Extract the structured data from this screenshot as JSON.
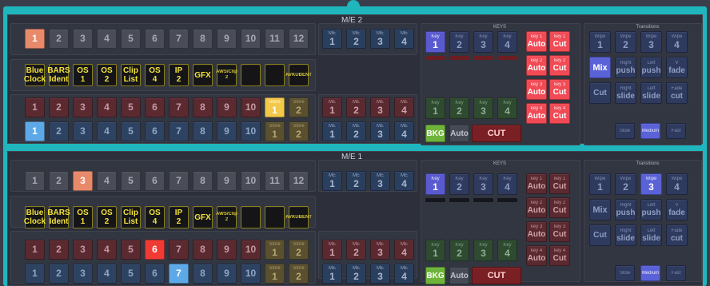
{
  "banks": [
    {
      "title": "M/E 2",
      "keys_title": "KEYS",
      "transitions_title": "Transitions",
      "row1": {
        "labels": [
          "1",
          "2",
          "3",
          "4",
          "5",
          "6",
          "7",
          "8",
          "9",
          "10",
          "11",
          "12"
        ],
        "active_index": 0
      },
      "aux": [
        {
          "top": "Blue",
          "bottom": "Clock"
        },
        {
          "top": "BARS",
          "bottom": "Ident"
        },
        {
          "top": "OS",
          "bottom": "1"
        },
        {
          "top": "OS",
          "bottom": "2"
        },
        {
          "top": "Clip",
          "bottom": "List"
        },
        {
          "top": "OS",
          "bottom": "4"
        },
        {
          "top": "IP",
          "bottom": "2"
        },
        {
          "top": "GFX",
          "bottom": ""
        },
        {
          "top": "AWS/Clip",
          "bottom": "2"
        },
        {
          "top": "",
          "bottom": ""
        },
        {
          "top": "",
          "bottom": ""
        },
        {
          "top": "AVKUBENT",
          "bottom": ""
        }
      ],
      "program": {
        "labels": [
          "1",
          "2",
          "3",
          "4",
          "5",
          "6",
          "7",
          "8",
          "9",
          "10"
        ],
        "active_index": -1
      },
      "preview": {
        "labels": [
          "1",
          "2",
          "3",
          "4",
          "5",
          "6",
          "7",
          "8",
          "9",
          "10"
        ],
        "active_index": 0
      },
      "store_prog": [
        {
          "top": "Store",
          "bottom": "1",
          "on": true
        },
        {
          "top": "Store",
          "bottom": "2",
          "on": false
        }
      ],
      "store_prev": [
        {
          "top": "Store",
          "bottom": "1",
          "on": false
        },
        {
          "top": "Store",
          "bottom": "2",
          "on": false
        }
      ],
      "me_top": [
        {
          "t": "ME",
          "n": "1"
        },
        {
          "t": "ME",
          "n": "2"
        },
        {
          "t": "ME",
          "n": "3"
        },
        {
          "t": "ME",
          "n": "4"
        }
      ],
      "me_prog": [
        {
          "t": "ME",
          "n": "1"
        },
        {
          "t": "ME",
          "n": "2"
        },
        {
          "t": "ME",
          "n": "3"
        },
        {
          "t": "ME",
          "n": "4"
        }
      ],
      "me_prev": [
        {
          "t": "ME",
          "n": "1"
        },
        {
          "t": "ME",
          "n": "2"
        },
        {
          "t": "ME",
          "n": "3"
        },
        {
          "t": "ME",
          "n": "4"
        }
      ],
      "key_sel": [
        {
          "t": "Key",
          "n": "1",
          "on": true
        },
        {
          "t": "Key",
          "n": "2",
          "on": false
        },
        {
          "t": "Key",
          "n": "3",
          "on": false
        },
        {
          "t": "Key",
          "n": "4",
          "on": false
        }
      ],
      "key_bars": [
        "red",
        "red",
        "red",
        "red"
      ],
      "key_green": [
        {
          "t": "Key",
          "n": "1"
        },
        {
          "t": "Key",
          "n": "2"
        },
        {
          "t": "Key",
          "n": "3"
        },
        {
          "t": "Key",
          "n": "4"
        }
      ],
      "key_ac": [
        [
          {
            "t": "key 1",
            "n": "Auto",
            "on": true
          },
          {
            "t": "key 1",
            "n": "Cut",
            "on": true
          }
        ],
        [
          {
            "t": "key 2",
            "n": "Auto",
            "on": true
          },
          {
            "t": "key 2",
            "n": "Cut",
            "on": true
          }
        ],
        [
          {
            "t": "key 3",
            "n": "Auto",
            "on": true
          },
          {
            "t": "key 3",
            "n": "Cut",
            "on": true
          }
        ],
        [
          {
            "t": "key 4",
            "n": "Auto",
            "on": true
          },
          {
            "t": "key 4",
            "n": "Cut",
            "on": true
          }
        ]
      ],
      "bkg": {
        "label": "BKG",
        "on": true
      },
      "auto_label": "Auto",
      "cut_label": "CUT",
      "wipes": [
        {
          "t": "Wipe",
          "n": "1",
          "on": false
        },
        {
          "t": "Wipe",
          "n": "2",
          "on": false
        },
        {
          "t": "Wipe",
          "n": "3",
          "on": false
        },
        {
          "t": "Wipe",
          "n": "4",
          "on": false
        }
      ],
      "mix": {
        "label": "Mix",
        "on": true
      },
      "pushes": [
        {
          "t": "Right",
          "n": "push"
        },
        {
          "t": "Left",
          "n": "push"
        },
        {
          "t": "V",
          "n": "fade"
        }
      ],
      "cut_tr": {
        "label": "Cut"
      },
      "slides": [
        {
          "t": "Right",
          "n": "slide"
        },
        {
          "t": "Left",
          "n": "slide"
        },
        {
          "t": "Fade",
          "n": "cut"
        }
      ],
      "speeds": [
        {
          "label": "Slow",
          "on": false
        },
        {
          "label": "Medium",
          "on": true
        },
        {
          "label": "Fast",
          "on": false
        }
      ]
    },
    {
      "title": "M/E 1",
      "keys_title": "KEYS",
      "transitions_title": "Transitions",
      "row1": {
        "labels": [
          "1",
          "2",
          "3",
          "4",
          "5",
          "6",
          "7",
          "8",
          "9",
          "10",
          "11",
          "12"
        ],
        "active_index": 2
      },
      "aux": [
        {
          "top": "Blue",
          "bottom": "Clock"
        },
        {
          "top": "BARS",
          "bottom": "Ident"
        },
        {
          "top": "OS",
          "bottom": "1"
        },
        {
          "top": "OS",
          "bottom": "2"
        },
        {
          "top": "Clip",
          "bottom": "List"
        },
        {
          "top": "OS",
          "bottom": "4"
        },
        {
          "top": "IP",
          "bottom": "2"
        },
        {
          "top": "GFX",
          "bottom": ""
        },
        {
          "top": "AWS/Clip",
          "bottom": "2"
        },
        {
          "top": "",
          "bottom": ""
        },
        {
          "top": "",
          "bottom": ""
        },
        {
          "top": "AVKUBENT",
          "bottom": ""
        }
      ],
      "program": {
        "labels": [
          "1",
          "2",
          "3",
          "4",
          "5",
          "6",
          "7",
          "8",
          "9",
          "10"
        ],
        "active_index": 5
      },
      "preview": {
        "labels": [
          "1",
          "2",
          "3",
          "4",
          "5",
          "6",
          "7",
          "8",
          "9",
          "10"
        ],
        "active_index": 6
      },
      "store_prog": [
        {
          "top": "Store",
          "bottom": "1",
          "on": false
        },
        {
          "top": "Store",
          "bottom": "2",
          "on": false
        }
      ],
      "store_prev": [
        {
          "top": "Store",
          "bottom": "1",
          "on": false
        },
        {
          "top": "Store",
          "bottom": "2",
          "on": false
        }
      ],
      "me_top": [
        {
          "t": "ME",
          "n": "1"
        },
        {
          "t": "ME",
          "n": "2"
        },
        {
          "t": "ME",
          "n": "3"
        },
        {
          "t": "ME",
          "n": "4"
        }
      ],
      "me_prog": [
        {
          "t": "ME",
          "n": "1"
        },
        {
          "t": "ME",
          "n": "2"
        },
        {
          "t": "ME",
          "n": "3"
        },
        {
          "t": "ME",
          "n": "4"
        }
      ],
      "me_prev": [
        {
          "t": "ME",
          "n": "1"
        },
        {
          "t": "ME",
          "n": "2"
        },
        {
          "t": "ME",
          "n": "3"
        },
        {
          "t": "ME",
          "n": "4"
        }
      ],
      "key_sel": [
        {
          "t": "Key",
          "n": "1",
          "on": true
        },
        {
          "t": "Key",
          "n": "2",
          "on": false
        },
        {
          "t": "Key",
          "n": "3",
          "on": false
        },
        {
          "t": "Key",
          "n": "4",
          "on": false
        }
      ],
      "key_bars": [
        "dark",
        "dark",
        "dark",
        "dark"
      ],
      "key_green": [
        {
          "t": "Key",
          "n": "1"
        },
        {
          "t": "Key",
          "n": "2"
        },
        {
          "t": "Key",
          "n": "3"
        },
        {
          "t": "Key",
          "n": "4"
        }
      ],
      "key_ac": [
        [
          {
            "t": "key 1",
            "n": "Auto",
            "on": false
          },
          {
            "t": "key 1",
            "n": "Cut",
            "on": false
          }
        ],
        [
          {
            "t": "key 2",
            "n": "Auto",
            "on": false
          },
          {
            "t": "key 2",
            "n": "Cut",
            "on": false
          }
        ],
        [
          {
            "t": "key 3",
            "n": "Auto",
            "on": false
          },
          {
            "t": "key 3",
            "n": "Cut",
            "on": false
          }
        ],
        [
          {
            "t": "key 4",
            "n": "Auto",
            "on": false
          },
          {
            "t": "key 4",
            "n": "Cut",
            "on": false
          }
        ]
      ],
      "bkg": {
        "label": "BKG",
        "on": true
      },
      "auto_label": "Auto",
      "cut_label": "CUT",
      "wipes": [
        {
          "t": "Wipe",
          "n": "1",
          "on": false
        },
        {
          "t": "Wipe",
          "n": "2",
          "on": false
        },
        {
          "t": "Wipe",
          "n": "3",
          "on": true
        },
        {
          "t": "Wipe",
          "n": "4",
          "on": false
        }
      ],
      "mix": {
        "label": "Mix",
        "on": false
      },
      "pushes": [
        {
          "t": "Right",
          "n": "push"
        },
        {
          "t": "Left",
          "n": "push"
        },
        {
          "t": "V",
          "n": "fade"
        }
      ],
      "cut_tr": {
        "label": "Cut"
      },
      "slides": [
        {
          "t": "Right",
          "n": "slide"
        },
        {
          "t": "Left",
          "n": "slide"
        },
        {
          "t": "Fade",
          "n": "cut"
        }
      ],
      "speeds": [
        {
          "label": "Slow",
          "on": false
        },
        {
          "label": "Medium",
          "on": true
        },
        {
          "label": "Fast",
          "on": false
        }
      ]
    }
  ],
  "colors": {
    "frame": "#1fb6bd",
    "panel": "#2d303a",
    "active_gray": "#e8896a",
    "active_red": "#f23a35",
    "active_blue": "#5da9e8",
    "store_on": "#f2c84a",
    "bkg": "#6fb43a",
    "key_on": "#f24a55"
  }
}
